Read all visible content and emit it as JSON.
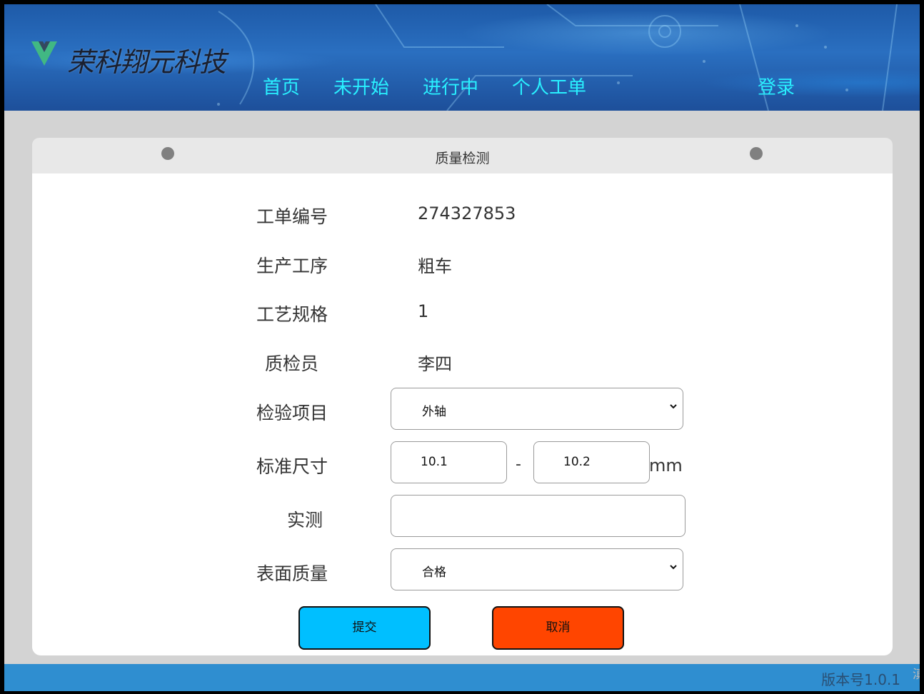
{
  "header": {
    "brand": "荣科翔元科技",
    "nav": [
      "首页",
      "未开始",
      "进行中",
      "个人工单"
    ],
    "login": "登录"
  },
  "card": {
    "title": "质量检测"
  },
  "form": {
    "order_no_label": "工单编号",
    "order_no": "274327853",
    "process_label": "生产工序",
    "process": "粗车",
    "spec_label": "工艺规格",
    "spec": "1",
    "inspector_label": "质检员",
    "inspector": "李四",
    "item_label": "检验项目",
    "item_selected": "外轴",
    "std_size_label": "标准尺寸",
    "std_min": "10.1",
    "std_sep": "-",
    "std_max": "10.2",
    "unit": "mm",
    "measured_label": "实测",
    "measured_value": "",
    "surface_label": "表面质量",
    "surface_selected": "合格"
  },
  "buttons": {
    "submit": "提交",
    "cancel": "取消"
  },
  "footer": {
    "version": "版本号1.0.1",
    "edge_text": "滇"
  },
  "colors": {
    "nav_text": "#29f0ff",
    "submit_bg": "#00bfff",
    "cancel_bg": "#ff4500",
    "footer_bg": "#2f8ed0",
    "page_bg": "#d3d3d3"
  }
}
